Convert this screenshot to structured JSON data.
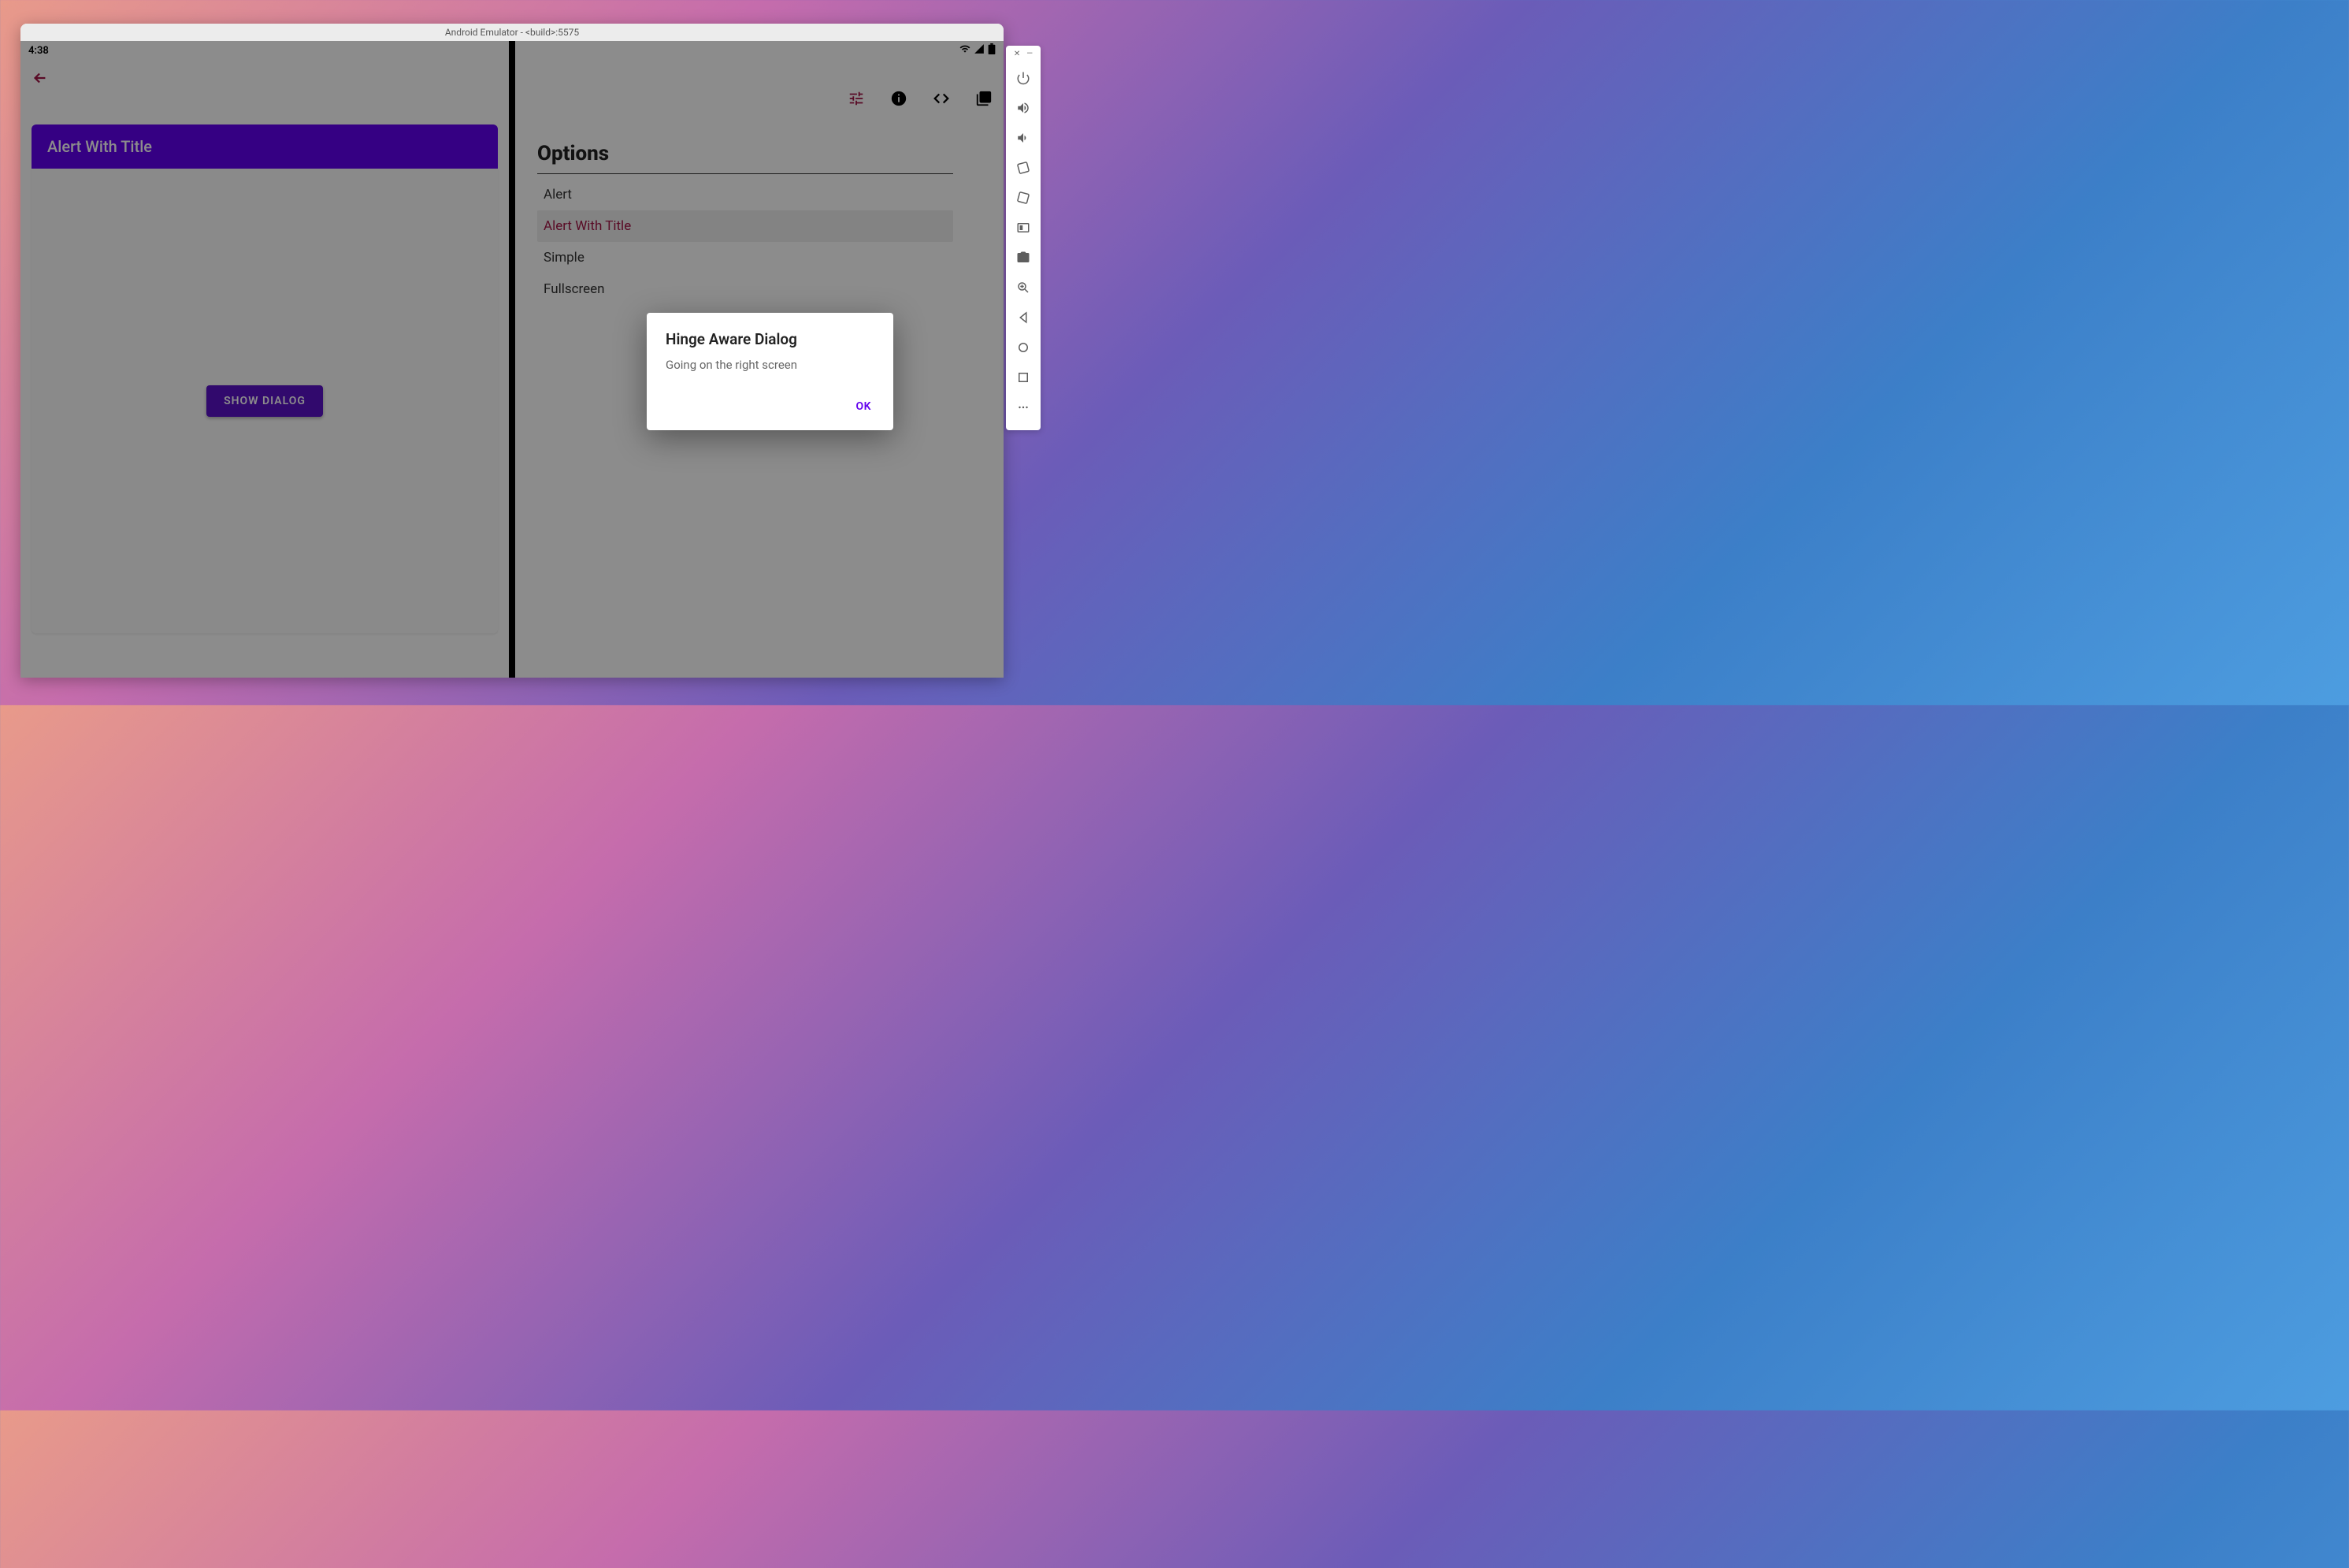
{
  "emulator_title": "Android Emulator - <build>:5575",
  "status_bar": {
    "time": "4:38"
  },
  "left_pane": {
    "header_title": "Alert With Title",
    "show_dialog_label": "SHOW DIALOG"
  },
  "right_pane": {
    "options_title": "Options",
    "options": [
      {
        "label": "Alert"
      },
      {
        "label": "Alert With Title"
      },
      {
        "label": "Simple"
      },
      {
        "label": "Fullscreen"
      }
    ]
  },
  "dialog": {
    "title": "Hinge Aware Dialog",
    "message": "Going on the right screen",
    "ok_label": "OK"
  },
  "colors": {
    "primary": "#6200ee",
    "accent": "#a31545"
  }
}
